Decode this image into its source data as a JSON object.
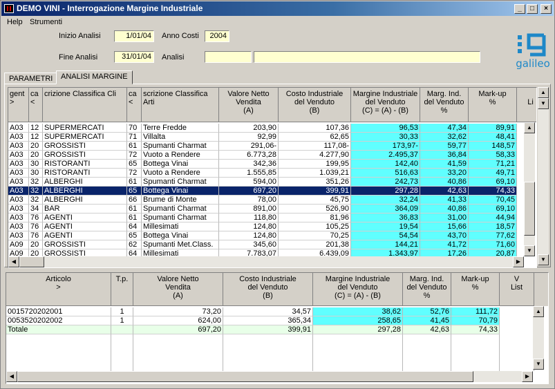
{
  "window": {
    "title": "DEMO VINI - Interrogazione Margine Industriale",
    "min": "_",
    "max": "□",
    "close": "×"
  },
  "menu": [
    "Help",
    "Strumenti"
  ],
  "filters": {
    "inizio_label": "Inizio Analisi",
    "inizio_value": "1/01/04",
    "anno_label": "Anno Costi",
    "anno_value": "2004",
    "fine_label": "Fine Analisi",
    "fine_value": "31/01/04",
    "analisi_label": "Analisi",
    "analisi_code": "",
    "analisi_desc": ""
  },
  "logo": {
    "text": "galileo",
    "color": "#1e88c8"
  },
  "tabs": [
    "PARAMETRI",
    "ANALISI MARGINE"
  ],
  "top_grid": {
    "headers": [
      "gent\n>",
      "ca\n<",
      "crizione Classifica Cli",
      "ca\n<",
      "scrizione Classifica Arti",
      "Valore Netto\nVendita\n(A)",
      "Costo Industriale\ndel Venduto\n(B)",
      "Margine Industriale\ndel Venduto\n(C) = (A) - (B)",
      "Marg. Ind.\ndel Venduto\n%",
      "Mark-up\n%",
      "\nLi"
    ],
    "rows": [
      [
        "A03",
        "12",
        "SUPERMERCATI",
        "70",
        "Terre Fredde",
        "203,90",
        "107,36",
        "96,53",
        "47,34",
        "89,91"
      ],
      [
        "A03",
        "12",
        "SUPERMERCATI",
        "71",
        "Villalta",
        "92,99",
        "62,65",
        "30,33",
        "32,62",
        "48,41"
      ],
      [
        "A03",
        "20",
        "GROSSISTI",
        "61",
        "Spumanti Charmat",
        "291,06-",
        "117,08-",
        "173,97-",
        "59,77",
        "148,57"
      ],
      [
        "A03",
        "20",
        "GROSSISTI",
        "72",
        "Vuoto a Rendere",
        "6.773,28",
        "4.277,90",
        "2.495,37",
        "36,84",
        "58,33"
      ],
      [
        "A03",
        "30",
        "RISTORANTI",
        "65",
        "Bottega Vinai",
        "342,36",
        "199,95",
        "142,40",
        "41,59",
        "71,21"
      ],
      [
        "A03",
        "30",
        "RISTORANTI",
        "72",
        "Vuoto a Rendere",
        "1.555,85",
        "1.039,21",
        "516,63",
        "33,20",
        "49,71"
      ],
      [
        "A03",
        "32",
        "ALBERGHI",
        "61",
        "Spumanti Charmat",
        "594,00",
        "351,26",
        "242,73",
        "40,86",
        "69,10"
      ],
      [
        "A03",
        "32",
        "ALBERGHI",
        "65",
        "Bottega Vinai",
        "697,20",
        "399,91",
        "297,28",
        "42,63",
        "74,33"
      ],
      [
        "A03",
        "32",
        "ALBERGHI",
        "66",
        "Brume di Monte",
        "78,00",
        "45,75",
        "32,24",
        "41,33",
        "70,45"
      ],
      [
        "A03",
        "34",
        "BAR",
        "61",
        "Spumanti Charmat",
        "891,00",
        "526,90",
        "364,09",
        "40,86",
        "69,10"
      ],
      [
        "A03",
        "76",
        "AGENTI",
        "61",
        "Spumanti Charmat",
        "118,80",
        "81,96",
        "36,83",
        "31,00",
        "44,94"
      ],
      [
        "A03",
        "76",
        "AGENTI",
        "64",
        "Millesimati",
        "124,80",
        "105,25",
        "19,54",
        "15,66",
        "18,57"
      ],
      [
        "A03",
        "76",
        "AGENTI",
        "65",
        "Bottega Vinai",
        "124,80",
        "70,25",
        "54,54",
        "43,70",
        "77,62"
      ],
      [
        "A09",
        "20",
        "GROSSISTI",
        "62",
        "Spumanti Met.Class.",
        "345,60",
        "201,38",
        "144,21",
        "41,72",
        "71,60"
      ],
      [
        "A09",
        "20",
        "GROSSISTI",
        "64",
        "Millesimati",
        "7.783,07",
        "6.439,09",
        "1.343,97",
        "17,26",
        "20,87"
      ]
    ],
    "selected_row": 7
  },
  "bottom_grid": {
    "headers": [
      "Articolo\n>",
      "T.p.",
      "Valore Netto\nVendita\n(A)",
      "Costo Industriale\ndel Venduto\n(B)",
      "Margine Industriale\ndel Venduto\n(C) = (A) - (B)",
      "Marg. Ind.\ndel Venduto\n%",
      "Mark-up\n%",
      "V\nList"
    ],
    "rows": [
      [
        "0015720202001",
        "1",
        "73,20",
        "34,57",
        "38,62",
        "52,76",
        "111,72"
      ],
      [
        "0053520202002",
        "1",
        "624,00",
        "365,34",
        "258,65",
        "41,45",
        "70,79"
      ]
    ],
    "total": [
      "Totale",
      "",
      "697,20",
      "399,91",
      "297,28",
      "42,63",
      "74,33"
    ]
  }
}
